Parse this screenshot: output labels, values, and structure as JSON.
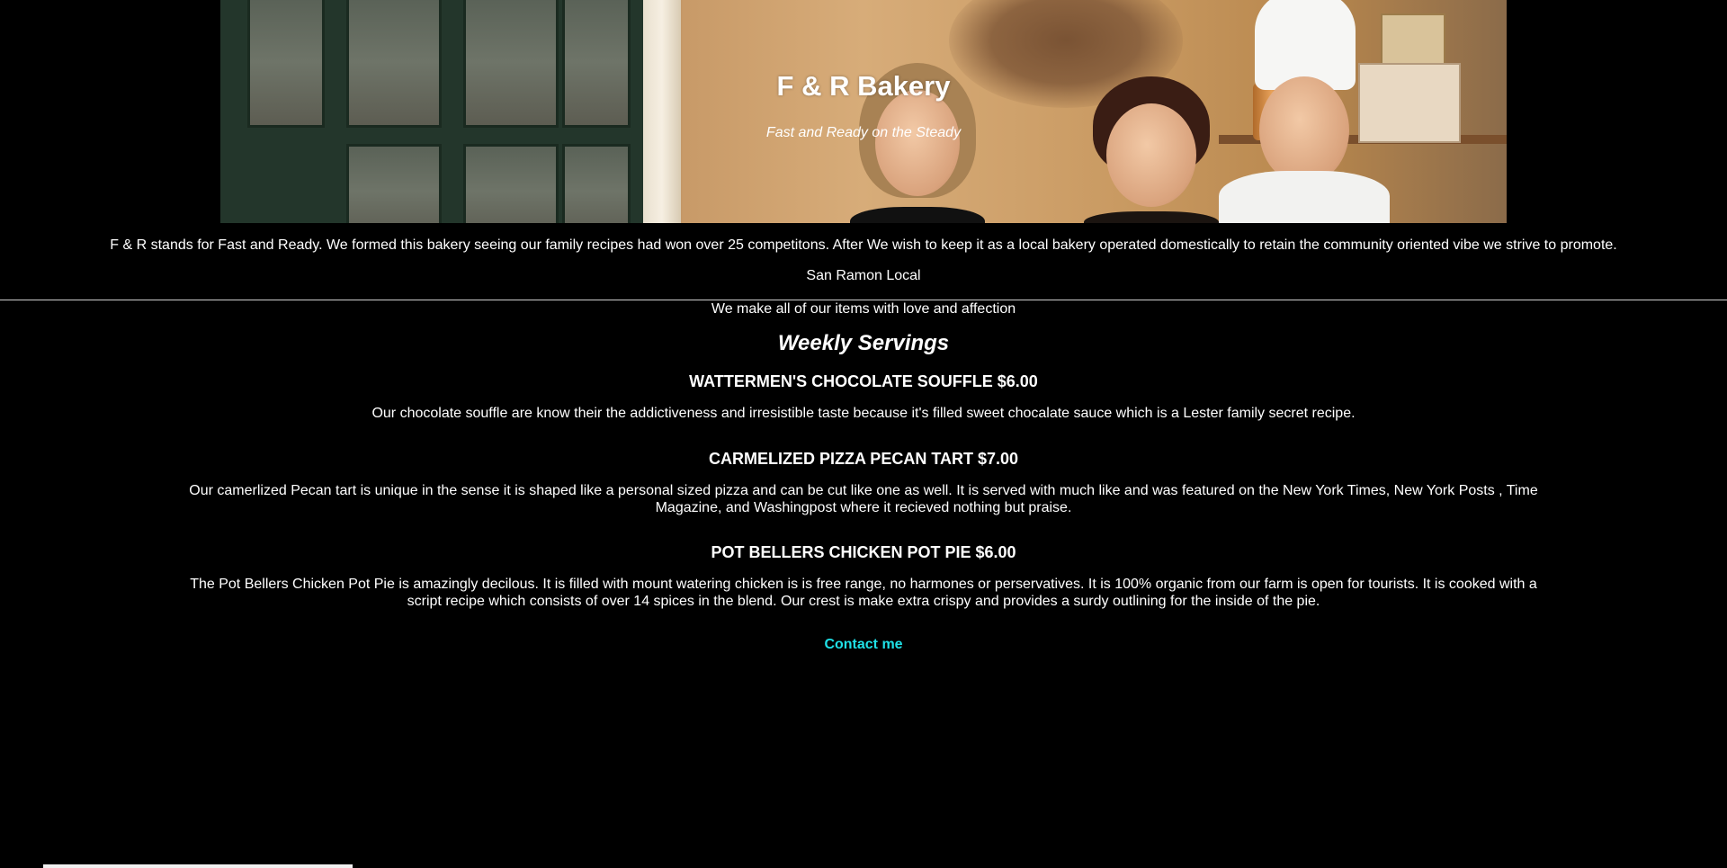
{
  "hero": {
    "title": "F & R Bakery",
    "tagline": "Fast and Ready on the Steady"
  },
  "intro": {
    "text": "F & R stands for Fast and Ready. We formed this bakery seeing our family recipes had won over 25 competitons. After We wish to keep it as a local bakery operated domestically to retain the community oriented vibe we strive to promote.",
    "location": "San Ramon Local"
  },
  "main": {
    "love_line": "We make all of our items with love and affection",
    "section_title": "Weekly Servings",
    "items": [
      {
        "title": "WATTERMEN'S CHOCOLATE SOUFFLE $6.00",
        "description": "Our chocolate souffle are know their the addictiveness and irresistible taste because it's filled sweet chocalate sauce which is a Lester family secret recipe."
      },
      {
        "title": "CARMELIZED PIZZA PECAN TART $7.00",
        "description": "Our camerlized Pecan tart is unique in the sense it is shaped like a personal sized pizza and can be cut like one as well. It is served with much like and was featured on the New York Times, New York Posts , Time Magazine, and Washingpost where it recieved nothing but praise."
      },
      {
        "title": "POT BELLERS CHICKEN POT PIE $6.00",
        "description": "The Pot Bellers Chicken Pot Pie is amazingly decilous. It is filled with mount watering chicken is is free range, no harmones or perservatives. It is 100% organic from our farm is open for tourists. It is cooked with a script recipe which consists of over 14 spices in the blend. Our crest is make extra crispy and provides a surdy outlining for the inside of the pie."
      }
    ],
    "contact_label": "Contact me"
  },
  "colors": {
    "background": "#000000",
    "text": "#ffffff",
    "link": "#1fe0e6"
  }
}
